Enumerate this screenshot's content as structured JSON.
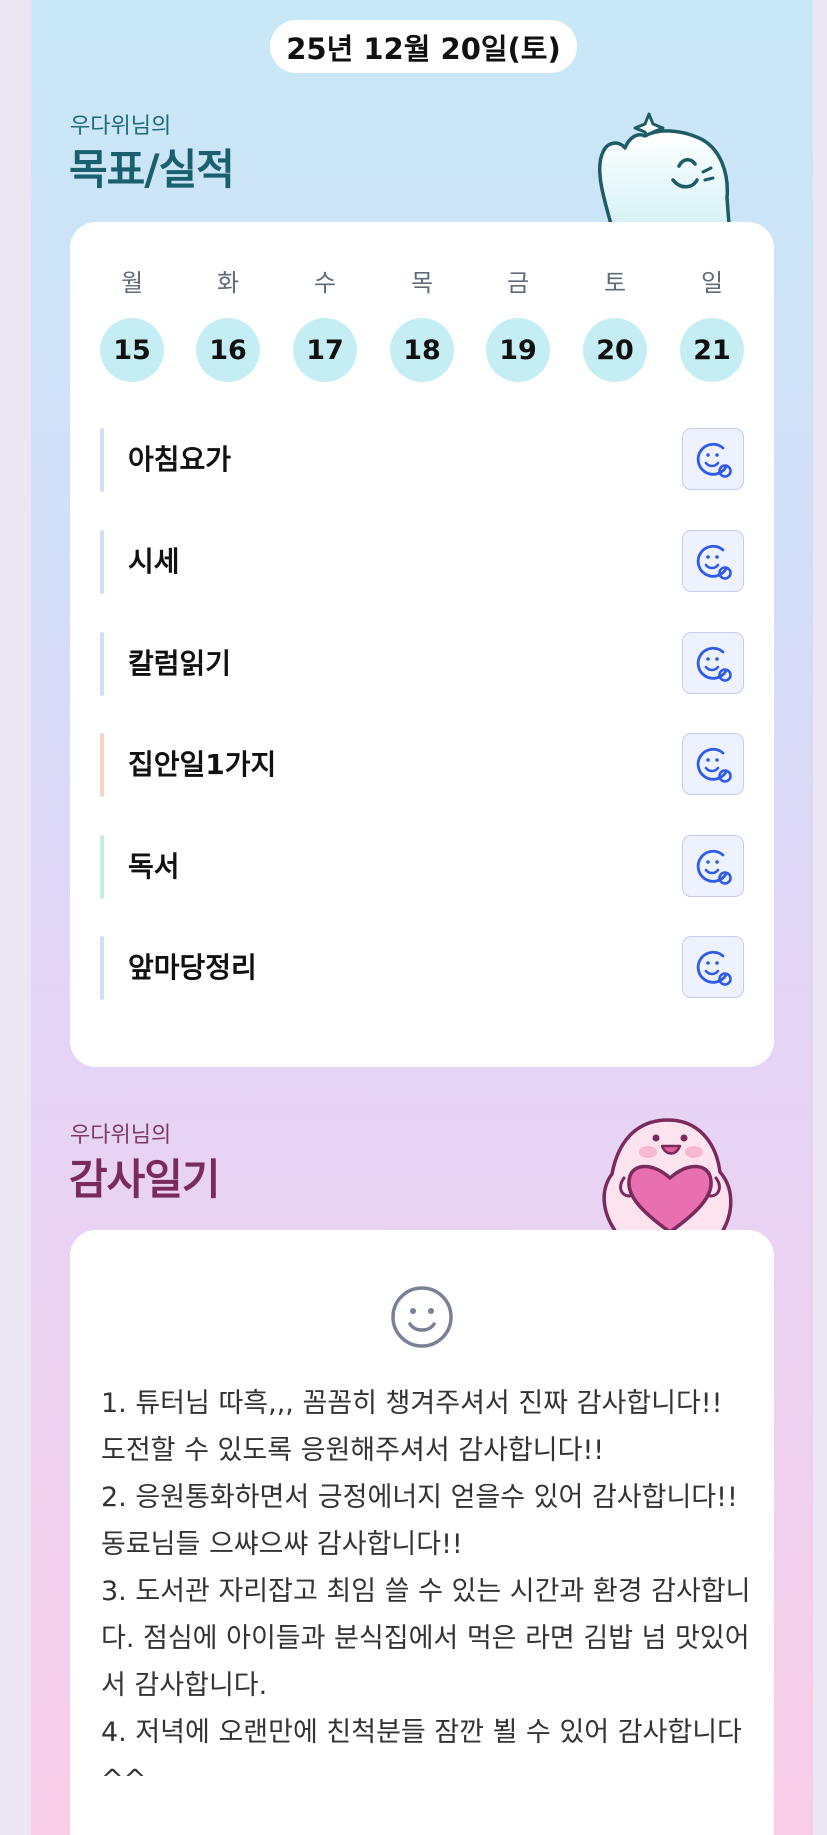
{
  "date": "25년 12월 20일(토)",
  "goal_section": {
    "owner": "우다위님의",
    "title": "목표/실적"
  },
  "week": [
    {
      "day": "월",
      "num": "15"
    },
    {
      "day": "화",
      "num": "16"
    },
    {
      "day": "수",
      "num": "17"
    },
    {
      "day": "목",
      "num": "18"
    },
    {
      "day": "금",
      "num": "19"
    },
    {
      "day": "토",
      "num": "20"
    },
    {
      "day": "일",
      "num": "21"
    }
  ],
  "goals": [
    {
      "label": "아침요가",
      "color": "#d3dcf5"
    },
    {
      "label": "시세",
      "color": "#d3dcf5"
    },
    {
      "label": "칼럼읽기",
      "color": "#d3dcf5"
    },
    {
      "label": "집안일1가지",
      "color": "#f8d3c6"
    },
    {
      "label": "독서",
      "color": "#c7ecdc"
    },
    {
      "label": "앞마당정리",
      "color": "#d3dcf5"
    }
  ],
  "gratitude_section": {
    "owner": "우다위님의",
    "title": "감사일기"
  },
  "gratitude_entries": [
    "1. 튜터님 따흑,,, 꼼꼼히 챙겨주셔서 진짜 감사합니다!! 도전할 수 있도록 응원해주셔서 감사합니다!!",
    "2. 응원통화하면서 긍정에너지 얻을수 있어 감사합니다!! 동료님들 으쌰으쌰 감사합니다!!",
    "3. 도서관 자리잡고 최임 쓸 수 있는 시간과 환경 감사합니다. 점심에 아이들과 분식집에서 먹은 라면 김밥 넘 맛있어서 감사합니다.",
    "4. 저녁에 오랜만에 친척분들 잠깐 뵐 수 있어 감사합니다^^"
  ],
  "colors": {
    "accent_teal": "#1a5f6e",
    "accent_plum": "#7a2a5c",
    "day_circle": "#c5eef4",
    "check_button_bg": "#eef1fe",
    "check_icon": "#2f5bea"
  },
  "icons": {
    "check_button": "smiley-plus-icon",
    "gratitude": "smiley-icon",
    "goal_mascot": "ghost-mascot-icon",
    "gratitude_mascot": "heart-mascot-icon"
  }
}
